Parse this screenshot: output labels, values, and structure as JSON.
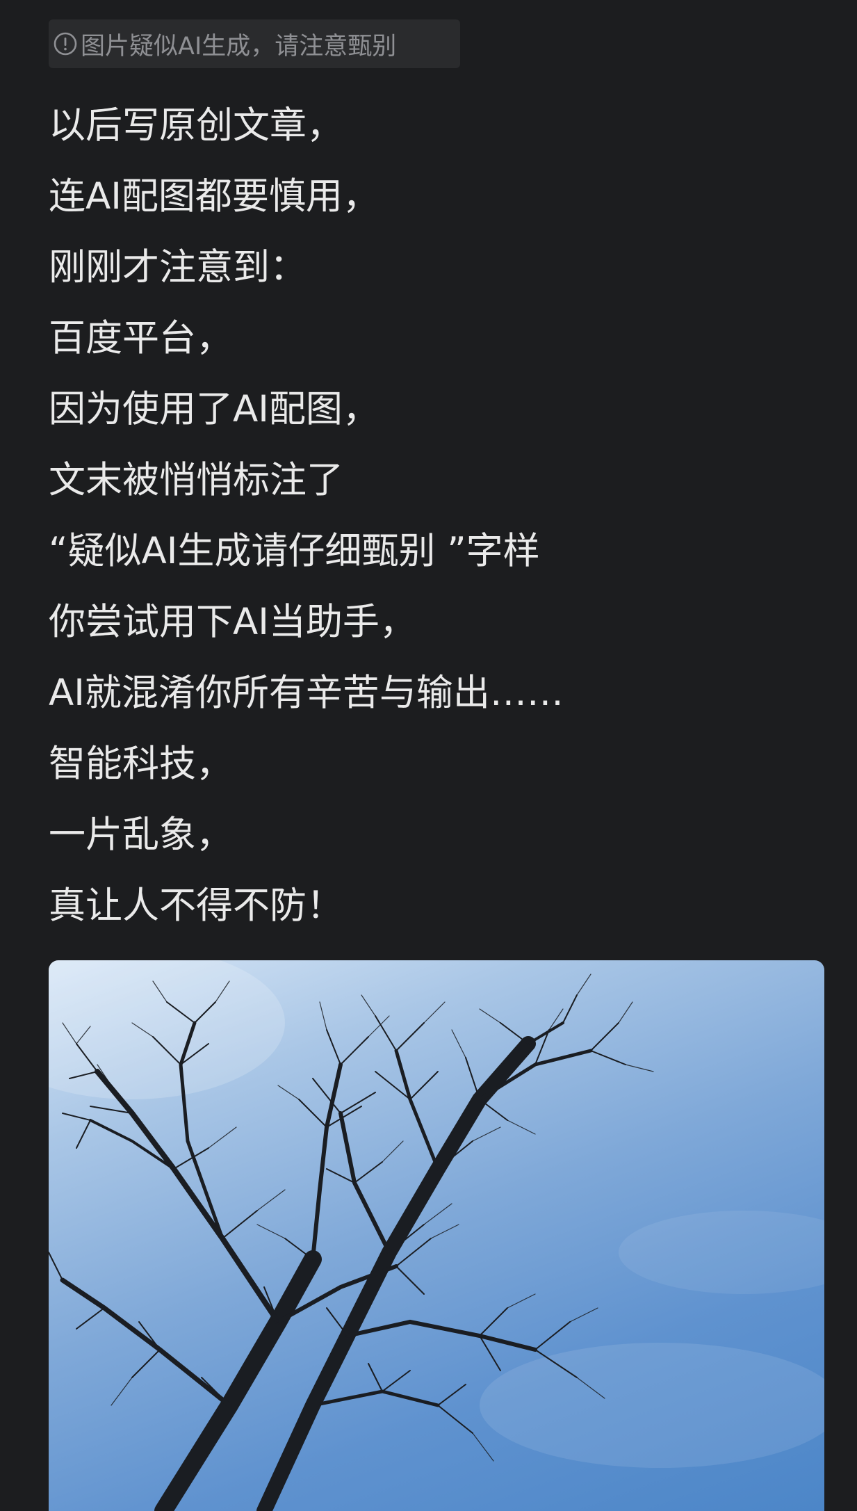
{
  "notice": {
    "icon": "exclamation-circle-icon",
    "text": "图片疑似AI生成，请注意甄别"
  },
  "post": {
    "lines": [
      "以后写原创文章，",
      "连AI配图都要慎用，",
      "刚刚才注意到：",
      "百度平台，",
      "因为使用了AI配图，",
      "文末被悄悄标注了",
      "“疑似AI生成请仔细甄别 ”字样",
      "你尝试用下AI当助手，",
      "AI就混淆你所有辛苦与输出……",
      "智能科技，",
      "一片乱象，",
      "真让人不得不防！"
    ]
  },
  "photo": {
    "subject": "bare tree branches against blue sky"
  },
  "colors": {
    "background": "#1c1d1f",
    "notice_bg": "#2a2b2d",
    "notice_text": "#8f9094",
    "body_text": "#eaeaea",
    "sky": "#5f92cf"
  }
}
